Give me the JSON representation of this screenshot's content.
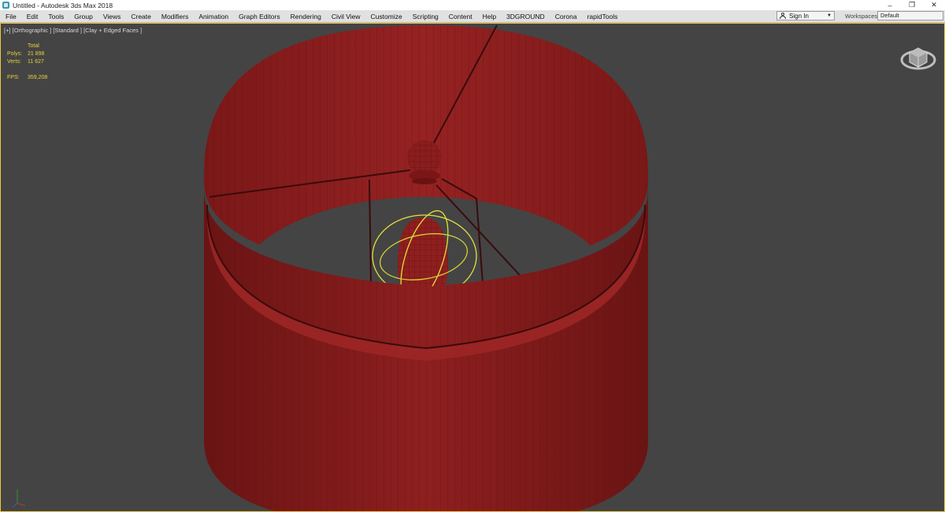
{
  "window": {
    "title": "Untitled - Autodesk 3ds Max 2018",
    "controls": {
      "minimize": "–",
      "restore": "❐",
      "close": "✕"
    }
  },
  "menu": {
    "items": [
      "File",
      "Edit",
      "Tools",
      "Group",
      "Views",
      "Create",
      "Modifiers",
      "Animation",
      "Graph Editors",
      "Rendering",
      "Civil View",
      "Customize",
      "Scripting",
      "Content",
      "Help",
      "3DGROUND",
      "Corona",
      "rapidTools"
    ],
    "sign_in": "Sign In",
    "workspaces_label": "Workspaces:",
    "workspaces_value": "Default"
  },
  "viewport": {
    "label": "[+] [Orthographic ] [Standard ] [Clay + Edged Faces ]",
    "stats": {
      "total_label": "Total",
      "polys_label": "Polys:",
      "polys_value": "21 898",
      "verts_label": "Verts:",
      "verts_value": "11 627",
      "fps_label": "FPS:",
      "fps_value": "359,208"
    }
  },
  "colors": {
    "viewport_bg": "#444444",
    "active_border": "#f0c83a",
    "model_red": "#8c1c1c",
    "gizmo_yellow": "#e6e13a",
    "stats_text": "#e8d23a"
  },
  "icons": [
    "app-icon",
    "user-icon",
    "viewcube-icon",
    "axis-tripod-icon"
  ]
}
